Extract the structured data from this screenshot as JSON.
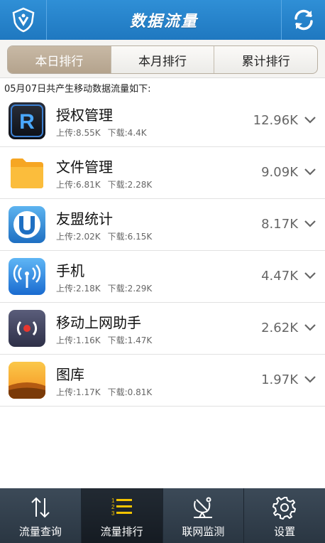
{
  "header": {
    "title": "数据流量",
    "left_icon": "shield-icon",
    "right_icon": "refresh-icon",
    "accent": "#2386cf"
  },
  "tabs": [
    {
      "label": "本日排行",
      "active": true
    },
    {
      "label": "本月排行",
      "active": false
    },
    {
      "label": "累计排行",
      "active": false
    }
  ],
  "summary": "05月07日共产生移动数据流量如下:",
  "apps": [
    {
      "name": "授权管理",
      "upload": "上传:8.55K",
      "download": "下载:4.4K",
      "total": "12.96K",
      "icon": "r-app-icon"
    },
    {
      "name": "文件管理",
      "upload": "上传:6.81K",
      "download": "下载:2.28K",
      "total": "9.09K",
      "icon": "folder-icon"
    },
    {
      "name": "友盟统计",
      "upload": "上传:2.02K",
      "download": "下载:6.15K",
      "total": "8.17K",
      "icon": "u-app-icon"
    },
    {
      "name": "手机",
      "upload": "上传:2.18K",
      "download": "下载:2.29K",
      "total": "4.47K",
      "icon": "antenna-icon"
    },
    {
      "name": "移动上网助手",
      "upload": "上传:1.16K",
      "download": "下载:1.47K",
      "total": "2.62K",
      "icon": "broadcast-icon"
    },
    {
      "name": "图库",
      "upload": "上传:1.17K",
      "download": "下载:0.81K",
      "total": "1.97K",
      "icon": "sunset-icon"
    }
  ],
  "bottom_nav": [
    {
      "label": "流量查询",
      "icon": "up-down-arrows-icon",
      "active": false
    },
    {
      "label": "流量排行",
      "icon": "ranking-list-icon",
      "active": true
    },
    {
      "label": "联网监测",
      "icon": "satellite-dish-icon",
      "active": false
    },
    {
      "label": "设置",
      "icon": "gear-icon",
      "active": false
    }
  ]
}
